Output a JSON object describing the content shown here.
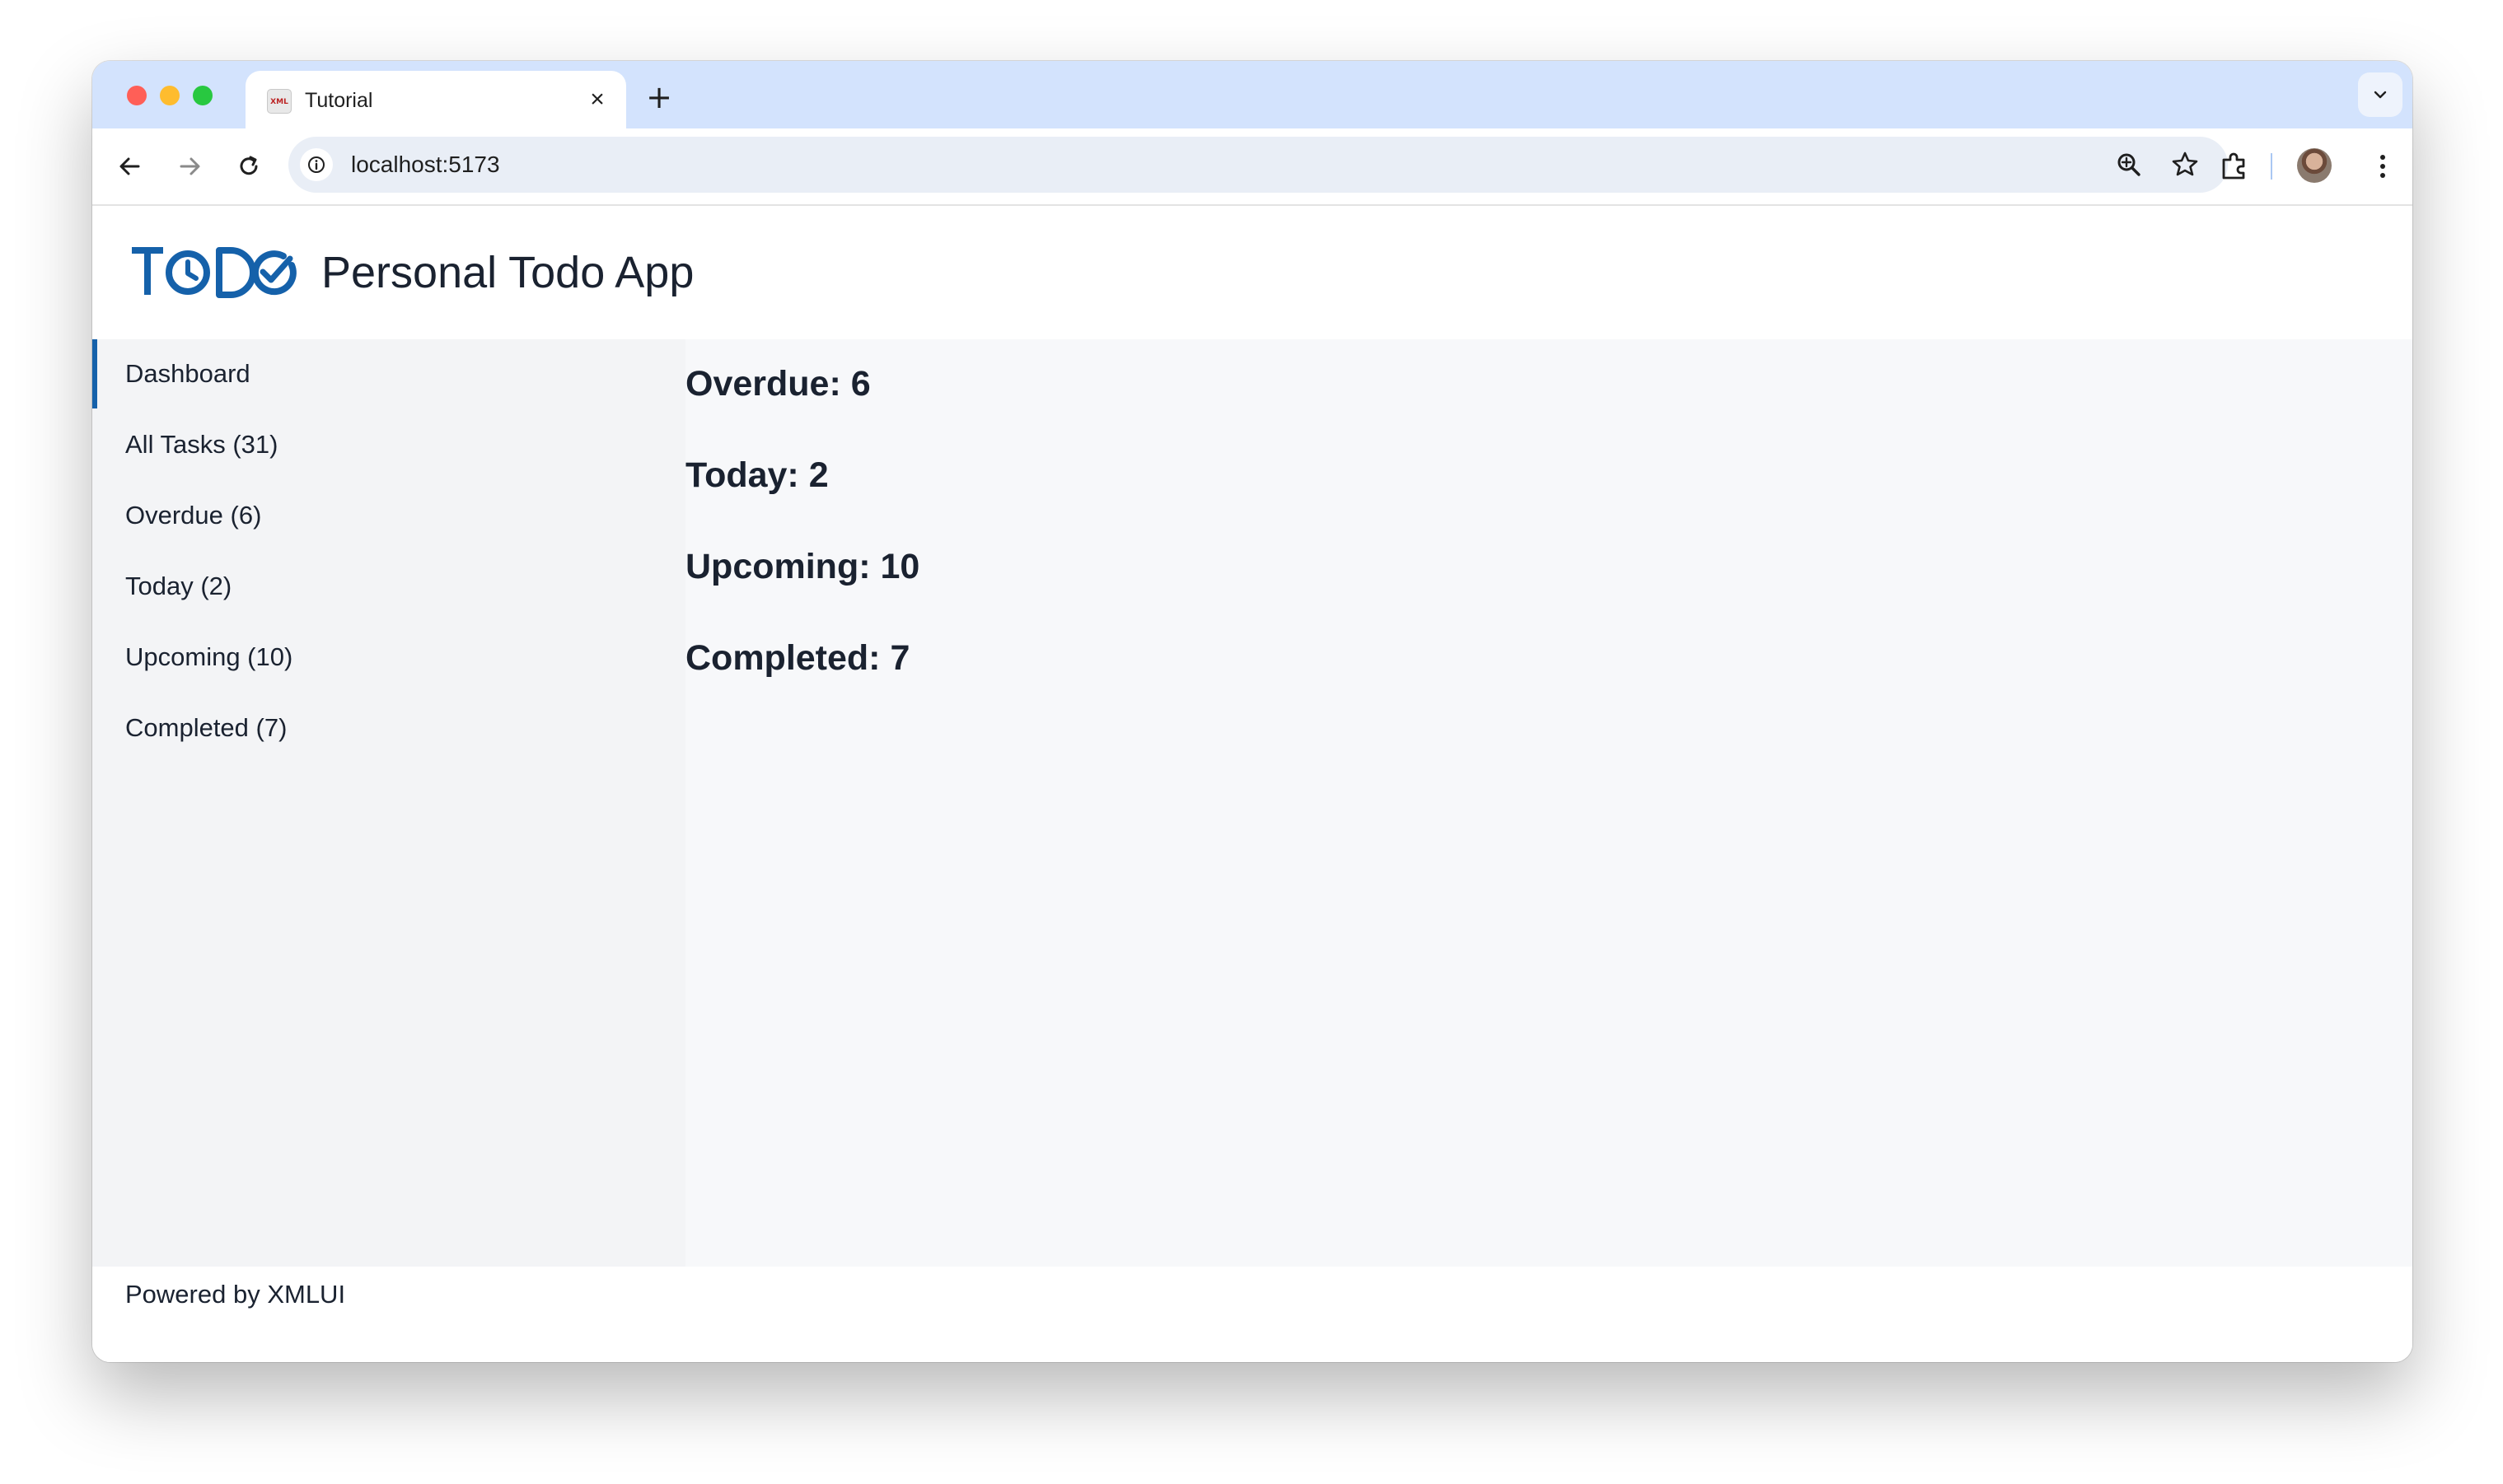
{
  "browser": {
    "tab": {
      "title": "Tutorial",
      "favicon_text": "XML"
    },
    "url": "localhost:5173",
    "icons": [
      "back-icon",
      "forward-icon",
      "reload-icon",
      "info-icon",
      "zoom-icon",
      "star-icon",
      "extensions-icon",
      "avatar",
      "menu-icon"
    ]
  },
  "app": {
    "logo_text": "TODO",
    "title": "Personal Todo App",
    "accent_color": "#1561aa"
  },
  "sidebar": {
    "items": [
      {
        "label": "Dashboard",
        "active": true
      },
      {
        "label": "All Tasks (31)"
      },
      {
        "label": "Overdue (6)"
      },
      {
        "label": "Today (2)"
      },
      {
        "label": "Upcoming (10)"
      },
      {
        "label": "Completed (7)"
      }
    ]
  },
  "dashboard": {
    "stats": [
      {
        "label": "Overdue: 6"
      },
      {
        "label": "Today: 2"
      },
      {
        "label": "Upcoming: 10"
      },
      {
        "label": "Completed: 7"
      }
    ]
  },
  "footer": {
    "text": "Powered by XMLUI"
  }
}
